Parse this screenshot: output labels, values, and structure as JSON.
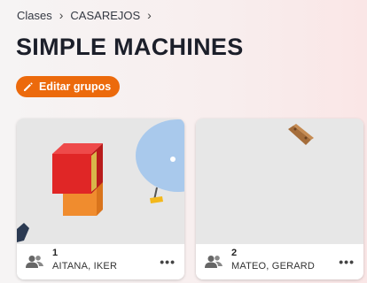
{
  "breadcrumb": {
    "root": "Clases",
    "current": "CASAREJOS"
  },
  "title": "SIMPLE MACHINES",
  "edit_button": {
    "label": "Editar grupos",
    "color": "#ec6a0c",
    "icon": "pencil-icon"
  },
  "groups": [
    {
      "number": "1",
      "members": "AITANA, IKER",
      "more": "•••"
    },
    {
      "number": "2",
      "members": "MATEO, GERARD",
      "more": "•••"
    }
  ]
}
